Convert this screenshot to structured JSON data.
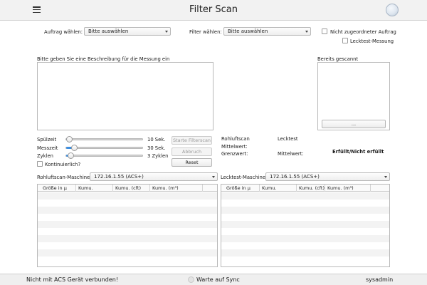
{
  "header": {
    "title": "Filter Scan",
    "menu_icon": "hamburger-menu-icon",
    "status_icon": "connection-status-icon"
  },
  "top": {
    "auftrag_label": "Auftrag wählen:",
    "auftrag_value": "Bitte auswählen",
    "filter_label": "Filter wählen:",
    "filter_value": "Bitte auswählen",
    "nicht_zugeordnet_label": "Nicht zugeordneter Auftrag",
    "lecktest_messung_label": "Lecktest-Messung"
  },
  "description": {
    "label": "Bitte geben Sie eine Beschreibung für die Messung ein",
    "value": ""
  },
  "scanned": {
    "label": "Bereits gescannt",
    "button_label": "..."
  },
  "sliders": [
    {
      "label": "Spülzeit",
      "value_text": "10 Sek.",
      "fraction": 0.0
    },
    {
      "label": "Messzeit",
      "value_text": "30 Sek.",
      "fraction": 0.07
    },
    {
      "label": "Zyklen",
      "value_text": "3 Zyklen",
      "fraction": 0.02
    }
  ],
  "kontinuierlich_label": "Kontinuierlich?",
  "buttons": {
    "start": "Starte Filterscan",
    "abort": "Abbruch",
    "reset": "Reset"
  },
  "results": {
    "rohluftscan": "Rohluftscan",
    "lecktest": "Lecktest",
    "mittelwert_label": "Mittelwert:",
    "grenzwert_label": "Grenzwert:",
    "mittelwert2_label": "Mittelwert:",
    "erfuellt": "Erfüllt/Nicht erfüllt"
  },
  "machines": {
    "rohluft_label": "Rohluftscan-Maschine:",
    "rohluft_value": "172.16.1.55 (ACS+)",
    "lecktest_label": "Lecktest-Maschine:",
    "lecktest_value": "172.16.1.55 (ACS+)"
  },
  "table_left": {
    "columns": [
      "Größe in µ",
      "Kumu.",
      "Kumu. (cft)",
      "Kumu. (m³)"
    ]
  },
  "table_right": {
    "columns": [
      "Größe in µ",
      "Kumu.",
      "Kumu. (cft)",
      "Kumu. (m³)"
    ]
  },
  "statusbar": {
    "left": "Nicht mit ACS Gerät verbunden!",
    "center": "Warte auf Sync",
    "right": "sysadmin"
  },
  "colors": {
    "accent": "#3d8ee0",
    "header_bg": "#f2f2f2"
  }
}
